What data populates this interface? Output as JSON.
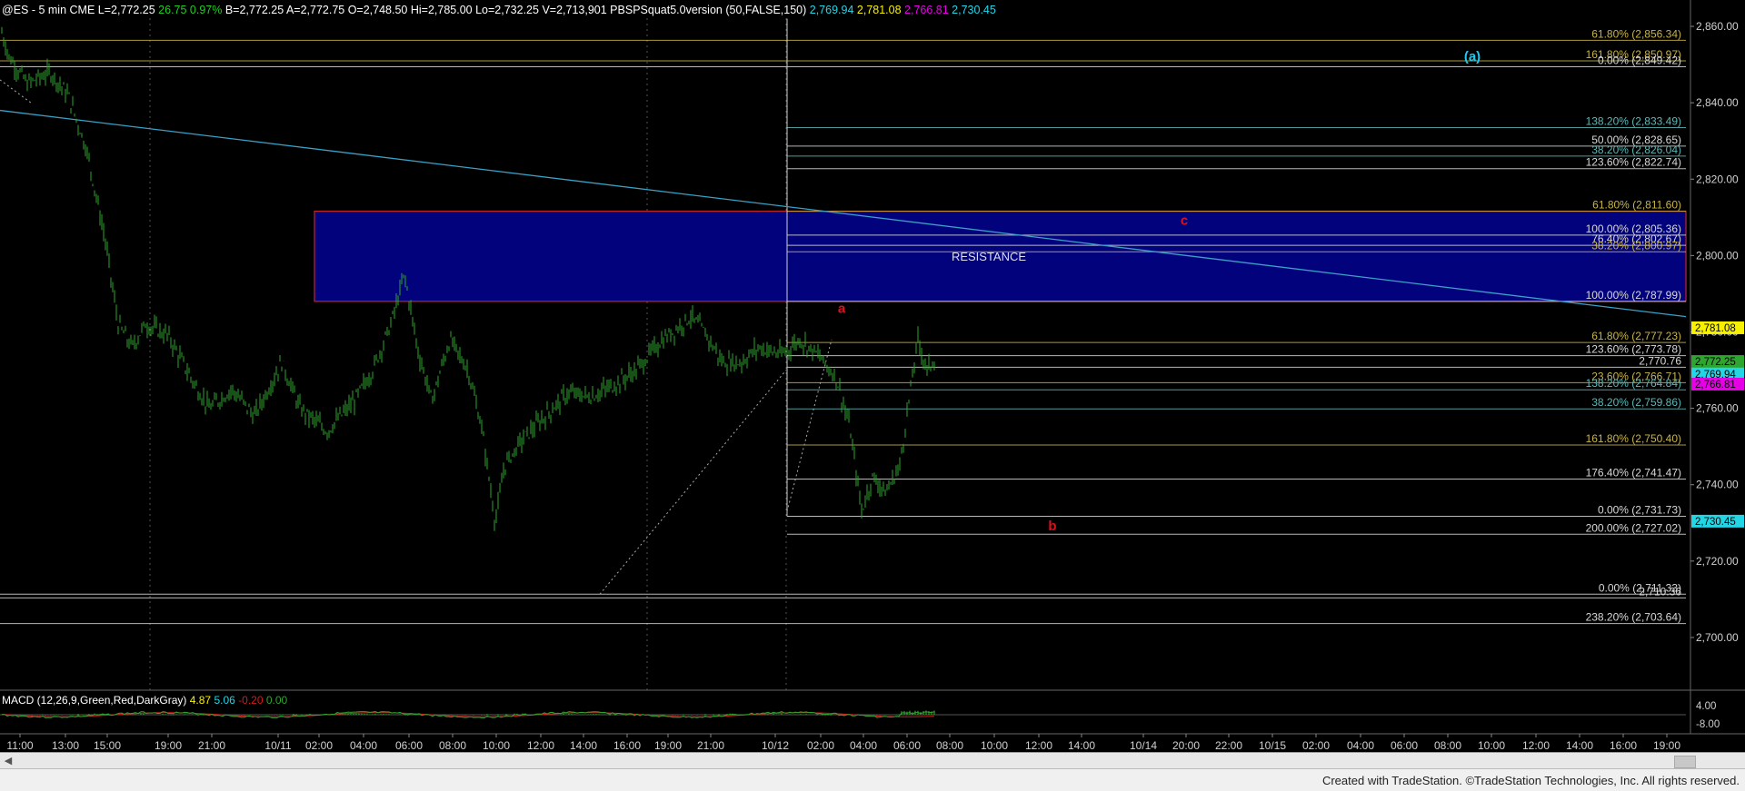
{
  "header": {
    "symbol": "@ES - 5 min  CME",
    "last": "L=2,772.25",
    "change": "26.75",
    "change_pct": "0.97%",
    "bid": "B=2,772.25",
    "ask": "A=2,772.75",
    "open": "O=2,748.50",
    "high": "Hi=2,785.00",
    "low": "Lo=2,732.25",
    "volume": "V=2,713,901",
    "study": "PBSPSquat5.0version (50,FALSE,150)",
    "study_values": [
      "2,769.94",
      "2,781.08",
      "2,766.81",
      "2,730.45"
    ]
  },
  "footer": {
    "credit": "Created with TradeStation. ©TradeStation Technologies, Inc. All rights reserved."
  },
  "colors": {
    "background": "#000000",
    "candles": "#2ea52e",
    "resistance_fill": "#02027d",
    "resistance_border": "#c0262b",
    "fib_gold": "#c8b34a",
    "fib_teal": "#5fb6b6",
    "fib_white": "#d8d8d8",
    "trendline": "#3aa0c8",
    "label_red": "#e0101a",
    "label_cyan": "#20c8ef",
    "tag_yellow": "#f7f100",
    "tag_cyan": "#22d6e6",
    "tag_magenta": "#e600e6",
    "macd_green": "#2ea52e",
    "macd_red": "#d81a1a"
  },
  "chart_data": {
    "type": "candlestick",
    "symbol": "@ES",
    "interval": "5 min",
    "ylim": [
      2690,
      2865
    ],
    "y_ticks": [
      "2,860.00",
      "2,840.00",
      "2,820.00",
      "2,800.00",
      "2,780.00",
      "2,760.00",
      "2,740.00",
      "2,720.00",
      "2,700.00"
    ],
    "x_ticks": [
      "11:00",
      "13:00",
      "15:00",
      "19:00",
      "21:00",
      "10/11",
      "02:00",
      "04:00",
      "06:00",
      "08:00",
      "10:00",
      "12:00",
      "14:00",
      "16:00",
      "19:00",
      "21:00",
      "10/12",
      "02:00",
      "04:00",
      "06:00",
      "08:00",
      "10:00",
      "12:00",
      "14:00",
      "10/14",
      "20:00",
      "22:00",
      "10/15",
      "02:00",
      "04:00",
      "06:00",
      "08:00",
      "10:00",
      "12:00",
      "14:00",
      "16:00",
      "19:00"
    ],
    "price_path": [
      [
        0,
        2860
      ],
      [
        10,
        2852
      ],
      [
        30,
        2845
      ],
      [
        55,
        2848
      ],
      [
        75,
        2842
      ],
      [
        95,
        2828
      ],
      [
        115,
        2805
      ],
      [
        130,
        2782
      ],
      [
        145,
        2776
      ],
      [
        160,
        2782
      ],
      [
        185,
        2779
      ],
      [
        210,
        2768
      ],
      [
        230,
        2760
      ],
      [
        255,
        2765
      ],
      [
        280,
        2758
      ],
      [
        310,
        2772
      ],
      [
        330,
        2760
      ],
      [
        360,
        2754
      ],
      [
        390,
        2762
      ],
      [
        410,
        2770
      ],
      [
        430,
        2782
      ],
      [
        445,
        2795
      ],
      [
        460,
        2775
      ],
      [
        475,
        2762
      ],
      [
        495,
        2778
      ],
      [
        515,
        2770
      ],
      [
        530,
        2755
      ],
      [
        545,
        2730
      ],
      [
        555,
        2745
      ],
      [
        575,
        2752
      ],
      [
        600,
        2758
      ],
      [
        625,
        2764
      ],
      [
        650,
        2763
      ],
      [
        675,
        2766
      ],
      [
        700,
        2770
      ],
      [
        725,
        2777
      ],
      [
        745,
        2781
      ],
      [
        760,
        2784
      ],
      [
        775,
        2780
      ],
      [
        795,
        2772
      ],
      [
        815,
        2772
      ],
      [
        835,
        2776
      ],
      [
        860,
        2774
      ],
      [
        880,
        2778
      ],
      [
        900,
        2774
      ],
      [
        920,
        2768
      ],
      [
        935,
        2755
      ],
      [
        948,
        2733
      ],
      [
        960,
        2742
      ],
      [
        975,
        2738
      ],
      [
        990,
        2745
      ],
      [
        1000,
        2762
      ],
      [
        1010,
        2778
      ],
      [
        1020,
        2770
      ],
      [
        1028,
        2773
      ]
    ],
    "resistance_zone": {
      "label": "RESISTANCE",
      "from": 2788.0,
      "to": 2811.6
    },
    "wave_labels": [
      {
        "text": "a",
        "price": 2785.0
      },
      {
        "text": "b",
        "price": 2728.0
      },
      {
        "text": "c",
        "price": 2808.0
      },
      {
        "text": "(a)",
        "price": 2851.0
      }
    ],
    "fib_levels": [
      {
        "label": "61.80% (2,856.34)",
        "price": 2856.34,
        "color": "gold"
      },
      {
        "label": "161.80% (2,850.97)",
        "price": 2850.97,
        "color": "gold"
      },
      {
        "label": "0.00% (2,849.42)",
        "price": 2849.42,
        "color": "white"
      },
      {
        "label": "138.20% (2,833.49)",
        "price": 2833.49,
        "color": "teal"
      },
      {
        "label": "50.00% (2,828.65)",
        "price": 2828.65,
        "color": "white"
      },
      {
        "label": "38.20% (2,826.04)",
        "price": 2826.04,
        "color": "teal"
      },
      {
        "label": "123.60% (2,822.74)",
        "price": 2822.74,
        "color": "white"
      },
      {
        "label": "61.80% (2,811.60)",
        "price": 2811.6,
        "color": "gold"
      },
      {
        "label": "100.00% (2,805.36)",
        "price": 2805.36,
        "color": "white"
      },
      {
        "label": "76.40% (2,802.67)",
        "price": 2802.67,
        "color": "white"
      },
      {
        "label": "38.20% (2,800.97)",
        "price": 2800.97,
        "color": "gold"
      },
      {
        "label": "100.00% (2,787.99)",
        "price": 2787.99,
        "color": "white"
      },
      {
        "label": "61.80% (2,777.23)",
        "price": 2777.23,
        "color": "gold"
      },
      {
        "label": "123.60% (2,773.78)",
        "price": 2773.78,
        "color": "white"
      },
      {
        "label": "2,770.76",
        "price": 2770.76,
        "color": "white"
      },
      {
        "label": "23.60% (2,766.71)",
        "price": 2766.71,
        "color": "gold"
      },
      {
        "label": "138.20% (2,764.84)",
        "price": 2764.84,
        "color": "teal"
      },
      {
        "label": "38.20% (2,759.86)",
        "price": 2759.86,
        "color": "teal"
      },
      {
        "label": "161.80% (2,750.40)",
        "price": 2750.4,
        "color": "gold"
      },
      {
        "label": "176.40% (2,741.47)",
        "price": 2741.47,
        "color": "white"
      },
      {
        "label": "0.00% (2,731.73)",
        "price": 2731.73,
        "color": "white"
      },
      {
        "label": "200.00% (2,727.02)",
        "price": 2727.02,
        "color": "white"
      },
      {
        "label": "0.00% (2,711.33)",
        "price": 2711.33,
        "color": "white"
      },
      {
        "label": "2,710.36",
        "price": 2710.36,
        "color": "white"
      },
      {
        "label": "238.20% (2,703.64)",
        "price": 2703.64,
        "color": "white"
      }
    ],
    "price_tags": [
      {
        "text": "2,781.08",
        "price": 2781.08,
        "color": "yellow"
      },
      {
        "text": "2,772.25",
        "price": 2772.25,
        "color": "green"
      },
      {
        "text": "2,769.94",
        "price": 2769.94,
        "color": "cyan"
      },
      {
        "text": "2,766.81",
        "price": 2766.81,
        "color": "magenta"
      },
      {
        "text": "2,730.45",
        "price": 2730.45,
        "color": "cyan"
      }
    ],
    "macd": {
      "label": "MACD (12,26,9,Green,Red,DarkGray)",
      "values": [
        "4.87",
        "5.06",
        "-0.20",
        "0.00"
      ],
      "axis_ticks": [
        "4.00",
        "-8.00"
      ]
    }
  }
}
